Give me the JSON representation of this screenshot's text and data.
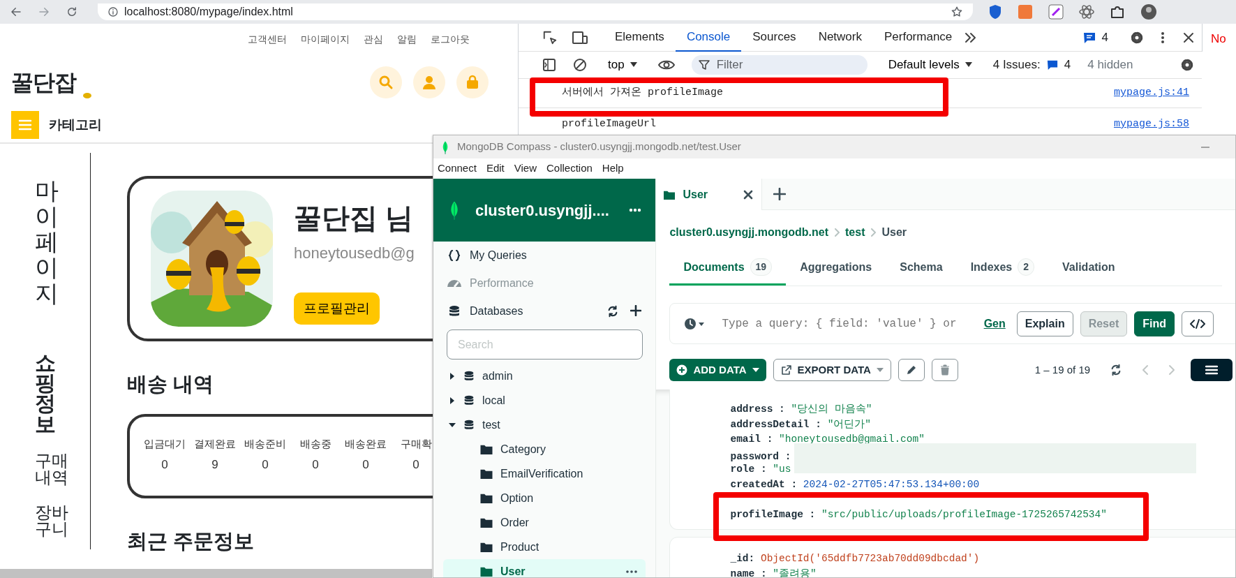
{
  "browser": {
    "url": "localhost:8080/mypage/index.html"
  },
  "page": {
    "top_links": [
      "고객센터",
      "마이페이지",
      "관심",
      "알림",
      "로그아웃"
    ],
    "logo": "꿀단잡",
    "category_label": "카테고리",
    "sidebar": {
      "title": "마이페이지",
      "section": "쇼핑정보",
      "links": [
        "구매내역",
        "장바구니"
      ]
    },
    "profile": {
      "name": "꿀단집 님",
      "email": "honeytousedb@g",
      "button": "프로필관리"
    },
    "delivery": {
      "title": "배송 내역",
      "statuses": [
        {
          "label": "입금대기",
          "count": "0"
        },
        {
          "label": "결제완료",
          "count": "9"
        },
        {
          "label": "배송준비",
          "count": "0"
        },
        {
          "label": "배송중",
          "count": "0"
        },
        {
          "label": "배송완료",
          "count": "0"
        },
        {
          "label": "구매확",
          "count": "0"
        }
      ]
    },
    "recent_title": "최근 주문정보"
  },
  "devtools": {
    "tabs": [
      {
        "label": "Elements",
        "selected": false
      },
      {
        "label": "Console",
        "selected": true
      },
      {
        "label": "Sources",
        "selected": false
      },
      {
        "label": "Network",
        "selected": false
      },
      {
        "label": "Performance",
        "selected": false
      }
    ],
    "message_count": "4",
    "context": "top",
    "filter_placeholder": "Filter",
    "levels": "Default levels",
    "issues_label": "4 Issues:",
    "issues_count": "4",
    "hidden": "4 hidden",
    "messages": [
      {
        "text": "서버에서 가져온 profileImage",
        "source": "mypage.js:41"
      },
      {
        "text": "profileImageUrl",
        "source": "mypage.js:58"
      }
    ]
  },
  "corner_text": "No",
  "compass": {
    "title": "MongoDB Compass - cluster0.usyngjj.mongodb.net/test.User",
    "menu": [
      "Connect",
      "Edit",
      "View",
      "Collection",
      "Help"
    ],
    "cluster": "cluster0.usyngjj....",
    "nav": [
      {
        "kind": "queries",
        "label": "My Queries",
        "disabled": false
      },
      {
        "kind": "performance",
        "label": "Performance",
        "disabled": true
      },
      {
        "kind": "databases",
        "label": "Databases",
        "disabled": false
      }
    ],
    "search_placeholder": "Search",
    "databases": [
      {
        "name": "admin",
        "expanded": false
      },
      {
        "name": "local",
        "expanded": false
      },
      {
        "name": "test",
        "expanded": true,
        "children": [
          {
            "name": "Category",
            "selected": false
          },
          {
            "name": "EmailVerification",
            "selected": false
          },
          {
            "name": "Option",
            "selected": false
          },
          {
            "name": "Order",
            "selected": false
          },
          {
            "name": "Product",
            "selected": false
          },
          {
            "name": "User",
            "selected": true
          }
        ]
      }
    ],
    "tab": "User",
    "breadcrumb": [
      "cluster0.usyngjj.mongodb.net",
      "test",
      "User"
    ],
    "subtabs": [
      {
        "label": "Documents",
        "count": "19",
        "selected": true
      },
      {
        "label": "Aggregations",
        "selected": false
      },
      {
        "label": "Schema",
        "selected": false
      },
      {
        "label": "Indexes",
        "count": "2",
        "selected": false
      },
      {
        "label": "Validation",
        "selected": false
      }
    ],
    "query": {
      "placeholder": "Type a query: { field: 'value' } or",
      "link": "Gen",
      "buttons": [
        {
          "label": "Explain",
          "kind": "outline",
          "disabled": false
        },
        {
          "label": "Reset",
          "kind": "outline",
          "disabled": true
        },
        {
          "label": "Find",
          "kind": "primary",
          "disabled": false
        }
      ]
    },
    "toolbar": {
      "add": "ADD DATA",
      "export": "EXPORT DATA",
      "range": "1 – 19 of 19"
    },
    "documents": [
      {
        "fields": [
          {
            "key": "address :",
            "value": "\"당신의 마음속\"",
            "kind": "string"
          },
          {
            "key": "addressDetail :",
            "value": "\"어딘가\"",
            "kind": "string"
          },
          {
            "key": "email :",
            "value": "\"honeytousedb@gmail.com\"",
            "kind": "string"
          },
          {
            "key": "password :",
            "kind": "masked"
          },
          {
            "key": "role :",
            "value": "\"us",
            "kind": "string"
          },
          {
            "key": "createdAt :",
            "value": "2024-02-27T05:47:53.134+00:00",
            "kind": "date"
          },
          {
            "key": "profileImage :",
            "value": "\"src/public/uploads/profileImage-1725265742534\"",
            "kind": "string"
          }
        ]
      },
      {
        "fields": [
          {
            "key": "_id:",
            "value": "ObjectId('65ddfb7723ab70dd09dbcdad')",
            "kind": "objectid"
          },
          {
            "key": "name :",
            "value": "\"졸려용\"",
            "kind": "string"
          }
        ]
      }
    ]
  }
}
